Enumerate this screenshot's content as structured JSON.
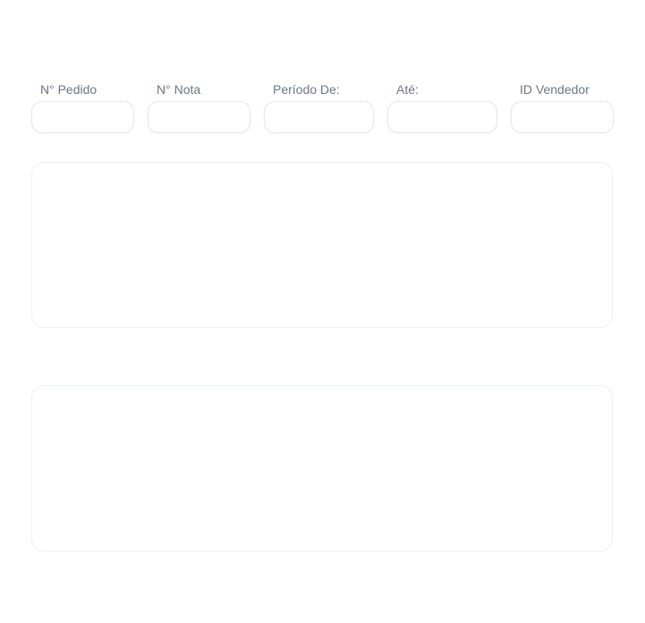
{
  "filters": {
    "pedido": {
      "label": "N° Pedido",
      "value": "",
      "placeholder": ""
    },
    "nota": {
      "label": "N° Nota",
      "value": "",
      "placeholder": ""
    },
    "periodo_de": {
      "label": "Período De:",
      "value": "",
      "placeholder": ""
    },
    "ate": {
      "label": "Até:",
      "value": "",
      "placeholder": ""
    },
    "vendedor": {
      "label": "ID Vendedor",
      "value": "",
      "placeholder": ""
    }
  },
  "colors": {
    "label": "#6b7785",
    "input_border": "#e3e7ec",
    "panel_border": "#eceff2",
    "background": "#ffffff"
  }
}
